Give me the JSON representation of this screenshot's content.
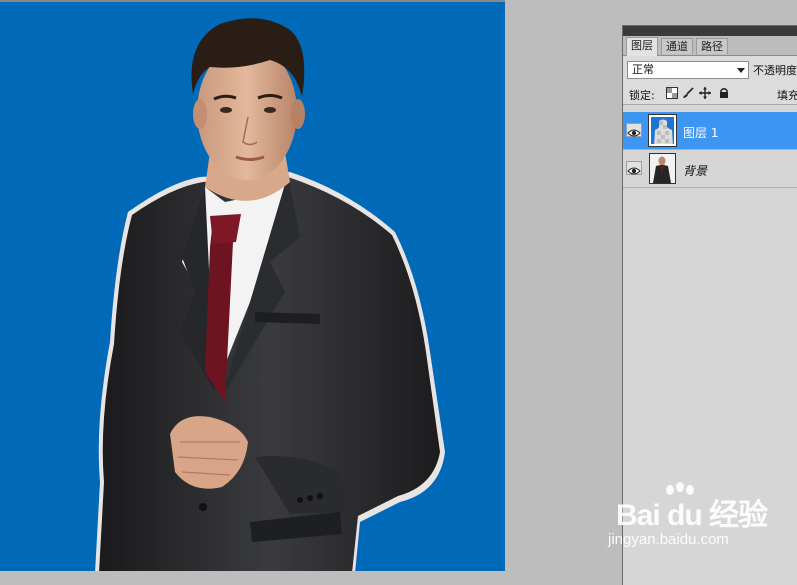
{
  "layers_panel": {
    "tabs": [
      {
        "label": "图层",
        "active": true
      },
      {
        "label": "通道",
        "active": false
      },
      {
        "label": "路径",
        "active": false
      }
    ],
    "blend_mode": "正常",
    "opacity_label": "不透明度",
    "lock_label": "锁定:",
    "lock_icons": [
      "lock-transparent-icon",
      "lock-brush-icon",
      "lock-move-icon",
      "lock-all-icon"
    ],
    "fill_label": "填充",
    "layers": [
      {
        "name": "图层 1",
        "selected": true,
        "visible": true
      },
      {
        "name": "背景",
        "selected": false,
        "visible": true
      }
    ]
  },
  "canvas": {
    "background_color": "#006ab8"
  },
  "watermark": {
    "brand": "Bai du 经验",
    "url": "jingyan.baidu.com"
  },
  "colors": {
    "selection": "#3d96f2",
    "canvas_bg": "#006ab8",
    "workspace": "#bdbdbd"
  }
}
